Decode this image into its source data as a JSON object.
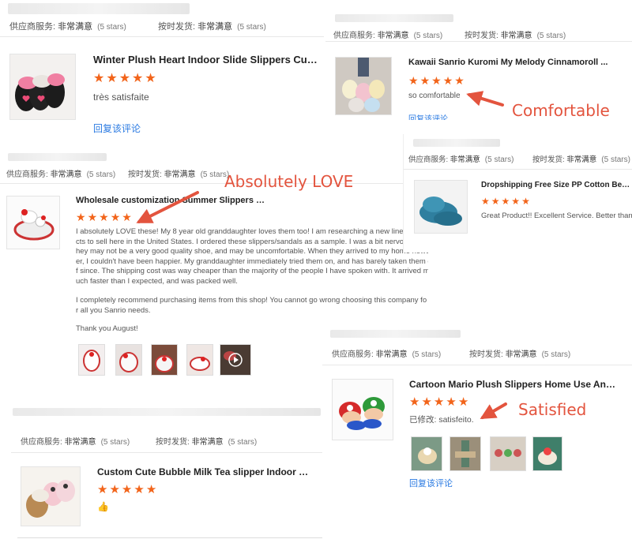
{
  "reviews": [
    {
      "supplier_service_label": "供应商服务:",
      "supplier_service_value": "非常满意",
      "supplier_service_stars": "(5 stars)",
      "shipping_label": "按时发货:",
      "shipping_value": "非常满意",
      "shipping_stars": "(5 stars)",
      "product_title": "Winter Plush Heart Indoor Slide Slippers Custo...",
      "rating": 5,
      "text": "très satisfaite",
      "reply_link": "回复该评论"
    },
    {
      "supplier_service_label": "供应商服务:",
      "supplier_service_value": "非常满意",
      "supplier_service_stars": "(5 stars)",
      "shipping_label": "按时发货:",
      "shipping_value": "非常满意",
      "shipping_stars": "(5 stars)",
      "product_title": "Kawaii Sanrio Kuromi My Melody Cinnamoroll ...",
      "rating": 5,
      "text": "so comfortable",
      "reply_link": "回复该评论"
    },
    {
      "supplier_service_label": "供应商服务:",
      "supplier_service_value": "非常满意",
      "supplier_service_stars": "(5 stars)",
      "shipping_label": "按时发货:",
      "shipping_value": "非常满意",
      "shipping_stars": "(5 stars)",
      "product_title": "Wholesale customization Summer Slippers Sa...",
      "rating": 5,
      "text_lines": [
        "I absolutely LOVE these! My 8 year old granddaughter loves them too! I am researching a new line o",
        "cts to sell here in the United States. I ordered these slippers/sandals as a sample. I was a bit nervous that t",
        "hey may not be a very good quality shoe, and may be uncomfortable. When they arrived to my home howev",
        "er, I couldn't have been happier. My granddaughter immediately tried them on, and has barely taken them of",
        "f since. The shipping cost was way cheaper than the majority of the people I have spoken with. It arrived m",
        "uch faster than I expected, and was packed well."
      ],
      "text_para2_lines": [
        "I completely recommend purchasing items from this shop! You cannot go wrong choosing this company fo",
        "r all you Sanrio needs."
      ],
      "text_para3": "Thank you August!"
    },
    {
      "supplier_service_label": "供应商服务:",
      "supplier_service_value": "非常满意",
      "supplier_service_stars": "(5 stars)",
      "shipping_label": "按时发货:",
      "shipping_value": "非常满意",
      "shipping_stars": "(5 stars)",
      "product_title": "Dropshipping Free Size PP Cotton Bedroo",
      "rating": 5,
      "text": "Great Product!! Excellent Service. Better than pi"
    },
    {
      "supplier_service_label": "供应商服务:",
      "supplier_service_value": "非常满意",
      "supplier_service_stars": "(5 stars)",
      "shipping_label": "按时发货:",
      "shipping_value": "非常满意",
      "shipping_stars": "(5 stars)",
      "product_title": "Cartoon Mario Plush Slippers Home Use Anim...",
      "rating": 5,
      "text": "已修改: satisfeito.",
      "reply_link": "回复该评论"
    },
    {
      "supplier_service_label": "供应商服务:",
      "supplier_service_value": "非常满意",
      "supplier_service_stars": "(5 stars)",
      "shipping_label": "按时发货:",
      "shipping_value": "非常满意",
      "shipping_stars": "(5 stars)",
      "product_title": "Custom Cute Bubble Milk Tea slipper Indoor Mi...",
      "rating": 5,
      "text": "👍"
    }
  ],
  "annotations": {
    "comfortable": "Comfortable",
    "absolutely_love": "Absolutely LOVE",
    "satisfied": "Satisfied"
  },
  "colors": {
    "star": "#f2641a",
    "link": "#2a7ae2",
    "annotation": "#e3543e"
  },
  "icons": {
    "star": "star-icon",
    "play": "play-icon",
    "thumbs_up": "thumbs-up-icon"
  }
}
